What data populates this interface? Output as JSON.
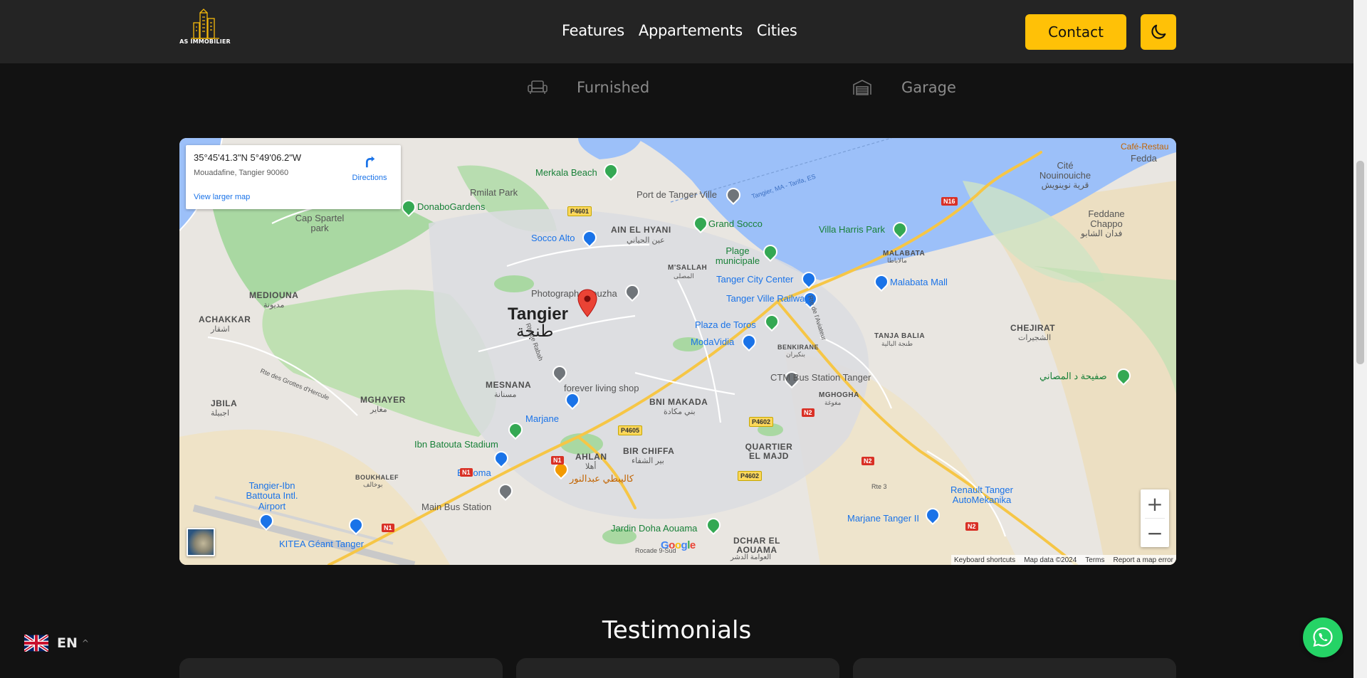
{
  "header": {
    "logo_text": "AS IMMOBILIER",
    "nav": [
      "Features",
      "Appartements",
      "Cities"
    ],
    "contact_label": "Contact",
    "theme_icon": "moon-icon",
    "accent_color": "#ffc107"
  },
  "amenities": [
    {
      "label": "Furnished",
      "icon": "sofa-icon"
    },
    {
      "label": "Garage",
      "icon": "garage-icon"
    }
  ],
  "map": {
    "info": {
      "coords": "35°45'41.3\"N 5°49'06.2\"W",
      "address": "Mouadafine, Tangier 90060",
      "view_larger": "View larger map",
      "directions": "Directions"
    },
    "city": {
      "name": "Tangier",
      "name_ar": "طنجة"
    },
    "areas": [
      {
        "name": "AIN EL HYANI",
        "ar": "عين الحياني"
      },
      {
        "name": "M'SALLAH",
        "ar": "المصلى"
      },
      {
        "name": "MEDIOUNA",
        "ar": "مديونة"
      },
      {
        "name": "ACHAKKAR",
        "ar": "اشقار"
      },
      {
        "name": "MESNANA",
        "ar": "مسنانة"
      },
      {
        "name": "MGHAYER",
        "ar": "مغاير"
      },
      {
        "name": "JBILA",
        "ar": "اجبيلة"
      },
      {
        "name": "BNI MAKADA",
        "ar": "بني مكادة"
      },
      {
        "name": "AHLAN",
        "ar": "أهلا"
      },
      {
        "name": "BIR CHIFFA",
        "ar": "بير الشفاء"
      },
      {
        "name": "QUARTIER EL MAJD",
        "ar": ""
      },
      {
        "name": "BOUKHALEF",
        "ar": "بوخالف"
      },
      {
        "name": "DCHAR EL AOUAMA",
        "ar": "العوامة الدشر"
      },
      {
        "name": "MGHOGHA",
        "ar": "مغوغة"
      },
      {
        "name": "BENKIRANE",
        "ar": "بنكيران"
      },
      {
        "name": "TANJA BALIA",
        "ar": "طنجة البالية"
      },
      {
        "name": "CHEJIRAT",
        "ar": "الشجيرات"
      },
      {
        "name": "MALABATA",
        "ar": "مالاباطا"
      }
    ],
    "pois": [
      {
        "name": "Merkala Beach",
        "type": "green"
      },
      {
        "name": "Rmilat Park",
        "type": "gray"
      },
      {
        "name": "DonaboGardens",
        "type": "green"
      },
      {
        "name": "Cap Spartel park",
        "type": "gray"
      },
      {
        "name": "Port de Tanger Ville",
        "type": "gray"
      },
      {
        "name": "Grand Socco",
        "type": "green"
      },
      {
        "name": "Socco Alto",
        "type": "blue"
      },
      {
        "name": "Plage municipale",
        "type": "green"
      },
      {
        "name": "Villa Harris Park",
        "type": "green"
      },
      {
        "name": "Tanger City Center",
        "type": "blue"
      },
      {
        "name": "Malabata Mall",
        "type": "blue"
      },
      {
        "name": "Photographe nouzha",
        "type": "gray"
      },
      {
        "name": "Tanger Ville Railway",
        "type": "blue"
      },
      {
        "name": "Plaza de Toros",
        "type": "green"
      },
      {
        "name": "ModaVidia",
        "type": "blue"
      },
      {
        "name": "forever living shop",
        "type": "gray"
      },
      {
        "name": "CTM Bus Station Tanger",
        "type": "gray"
      },
      {
        "name": "Marjane",
        "type": "blue"
      },
      {
        "name": "Ibn Batouta Stadium",
        "type": "green"
      },
      {
        "name": "Bricoma",
        "type": "blue"
      },
      {
        "name": "كاليبطي عبدالنور",
        "type": "orange"
      },
      {
        "name": "Main Bus Station",
        "type": "gray"
      },
      {
        "name": "Tangier-Ibn Battouta Intl. Airport",
        "type": "blue"
      },
      {
        "name": "KITEA Géant Tanger",
        "type": "blue"
      },
      {
        "name": "Jardin Doha Aouama",
        "type": "green"
      },
      {
        "name": "Renault Tanger AutoMekanika",
        "type": "blue"
      },
      {
        "name": "Marjane Tanger II",
        "type": "blue"
      },
      {
        "name": "Cité Nouinouiche",
        "type": "gray"
      },
      {
        "name": "قرية نوينويش",
        "type": "gray"
      },
      {
        "name": "Feddane Chappo",
        "type": "gray"
      },
      {
        "name": "فدان الشابو",
        "type": "gray"
      },
      {
        "name": "صفيحة د المصاني",
        "type": "green"
      },
      {
        "name": "Café-Restau",
        "type": "orange"
      },
      {
        "name": "Fedda",
        "type": "gray"
      }
    ],
    "roads": [
      "P4601",
      "N16",
      "N1",
      "N1",
      "N1",
      "P4605",
      "P4602",
      "P4602",
      "N2",
      "N2",
      "N2",
      "Rte 3",
      "Rte de Rabah",
      "Rte des Grottes d'Hercule",
      "Rte de l'Aviateur",
      "Rocade 9-Sud",
      "Tangier, MA - Tarifa, ES"
    ],
    "zoom_in": "+",
    "zoom_out": "−",
    "google": "Google",
    "attribution": [
      "Keyboard shortcuts",
      "Map data ©2024",
      "Terms",
      "Report a map error"
    ]
  },
  "testimonials": {
    "title": "Testimonials"
  },
  "language": {
    "code": "EN",
    "flag": "uk-flag-icon"
  },
  "whatsapp": {
    "icon": "whatsapp-icon",
    "color": "#25d366"
  }
}
